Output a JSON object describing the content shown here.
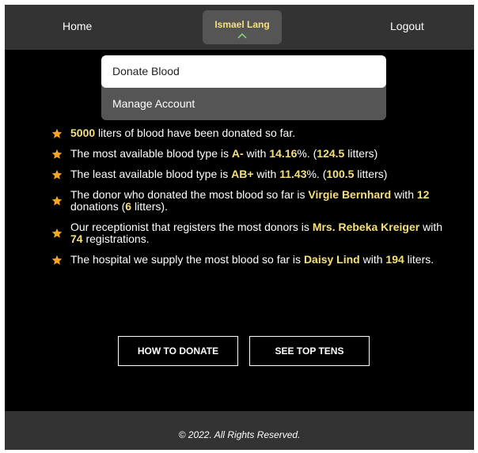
{
  "nav": {
    "home_label": "Home",
    "user_name": "Ismael Lang",
    "logout_label": "Logout"
  },
  "dropdown": {
    "items": [
      {
        "label": "Donate Blood"
      },
      {
        "label": "Manage Account"
      }
    ]
  },
  "facts": [
    {
      "parts": [
        {
          "t": "5000",
          "h": true
        },
        {
          "t": " liters of blood have been donated so far.",
          "h": false
        }
      ]
    },
    {
      "parts": [
        {
          "t": "The most available blood type is ",
          "h": false
        },
        {
          "t": "A-",
          "h": true
        },
        {
          "t": " with ",
          "h": false
        },
        {
          "t": "14.16",
          "h": true
        },
        {
          "t": "%. (",
          "h": false
        },
        {
          "t": "124.5",
          "h": true
        },
        {
          "t": " litters)",
          "h": false
        }
      ]
    },
    {
      "parts": [
        {
          "t": "The least available blood type is ",
          "h": false
        },
        {
          "t": "AB+",
          "h": true
        },
        {
          "t": " with ",
          "h": false
        },
        {
          "t": "11.43",
          "h": true
        },
        {
          "t": "%. (",
          "h": false
        },
        {
          "t": "100.5",
          "h": true
        },
        {
          "t": " litters)",
          "h": false
        }
      ]
    },
    {
      "parts": [
        {
          "t": "The donor who donated the most blood so far is ",
          "h": false
        },
        {
          "t": "Virgie Bernhard",
          "h": true
        },
        {
          "t": " with ",
          "h": false
        },
        {
          "t": "12",
          "h": true
        },
        {
          "t": " donations (",
          "h": false
        },
        {
          "t": "6",
          "h": true
        },
        {
          "t": " litters).",
          "h": false
        }
      ]
    },
    {
      "parts": [
        {
          "t": "Our receptionist that registers the most donors is ",
          "h": false
        },
        {
          "t": "Mrs. Rebeka Kreiger",
          "h": true
        },
        {
          "t": " with ",
          "h": false
        },
        {
          "t": "74",
          "h": true
        },
        {
          "t": " registrations.",
          "h": false
        }
      ]
    },
    {
      "parts": [
        {
          "t": "The hospital we supply the most blood so far is ",
          "h": false
        },
        {
          "t": "Daisy Lind",
          "h": true
        },
        {
          "t": " with ",
          "h": false
        },
        {
          "t": "194",
          "h": true
        },
        {
          "t": " liters.",
          "h": false
        }
      ]
    }
  ],
  "buttons": {
    "how_to_donate": "HOW TO DONATE",
    "see_top_tens": "SEE TOP TENS"
  },
  "footer": {
    "text": "© 2022. All Rights Reserved."
  },
  "colors": {
    "highlight": "#f5e07a",
    "star": "#f5a623",
    "navbar": "#333333",
    "background": "#000000"
  },
  "icons": {
    "fact_bullet": "star-icon",
    "user_menu_toggle": "chevron-up-icon"
  }
}
